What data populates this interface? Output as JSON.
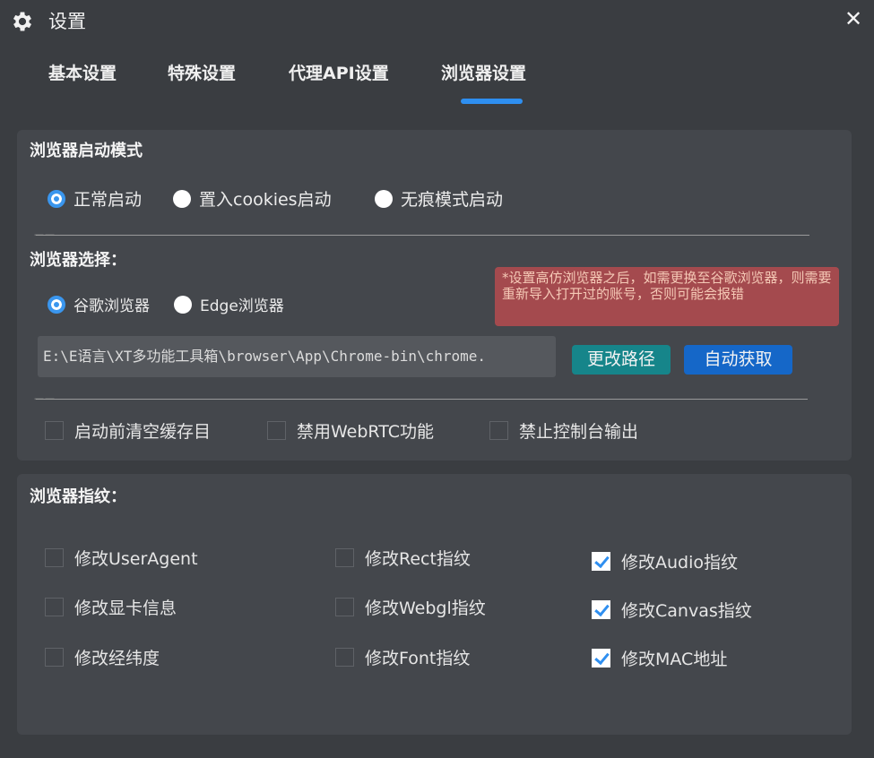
{
  "window": {
    "title": "设置",
    "close_glyph": "✕"
  },
  "tabs": [
    {
      "label": "基本设置",
      "active": false
    },
    {
      "label": "特殊设置",
      "active": false
    },
    {
      "label": "代理API设置",
      "active": false
    },
    {
      "label": "浏览器设置",
      "active": true
    }
  ],
  "launch_mode": {
    "heading": "浏览器启动模式",
    "options": [
      {
        "label": "正常启动",
        "checked": true
      },
      {
        "label": "置入cookies启动",
        "checked": false
      },
      {
        "label": "无痕模式启动",
        "checked": false
      }
    ]
  },
  "separator_text": "——",
  "browser_select": {
    "heading": "浏览器选择：",
    "options": [
      {
        "label": "谷歌浏览器",
        "checked": true
      },
      {
        "label": "Edge浏览器",
        "checked": false
      }
    ],
    "note": "*设置高仿浏览器之后，如需更换至谷歌浏览器，则需要重新导入打开过的账号，否则可能会报错",
    "path_value": "E:\\E语言\\XT多功能工具箱\\browser\\App\\Chrome-bin\\chrome.",
    "change_path_button": "更改路径",
    "auto_get_button": "自动获取"
  },
  "options_row": [
    {
      "label": "启动前清空缓存目",
      "checked": false
    },
    {
      "label": "禁用WebRTC功能",
      "checked": false
    },
    {
      "label": "禁止控制台输出",
      "checked": false
    }
  ],
  "fingerprint": {
    "heading": "浏览器指纹：",
    "items": [
      {
        "label": "修改UserAgent",
        "checked": false
      },
      {
        "label": "修改Rect指纹",
        "checked": false
      },
      {
        "label": "修改Audio指纹",
        "checked": true
      },
      {
        "label": "修改显卡信息",
        "checked": false
      },
      {
        "label": "修改Webgl指纹",
        "checked": false
      },
      {
        "label": "修改Canvas指纹",
        "checked": true
      },
      {
        "label": "修改经纬度",
        "checked": false
      },
      {
        "label": "修改Font指纹",
        "checked": false
      },
      {
        "label": "修改MAC地址",
        "checked": true
      }
    ]
  },
  "colors": {
    "accent": "#2e8ff0",
    "teal_button": "#16858a",
    "blue_button": "#1567c8",
    "note_bg": "#a44a4e"
  },
  "icons": {
    "title": "gear-icon",
    "close": "close-icon"
  }
}
